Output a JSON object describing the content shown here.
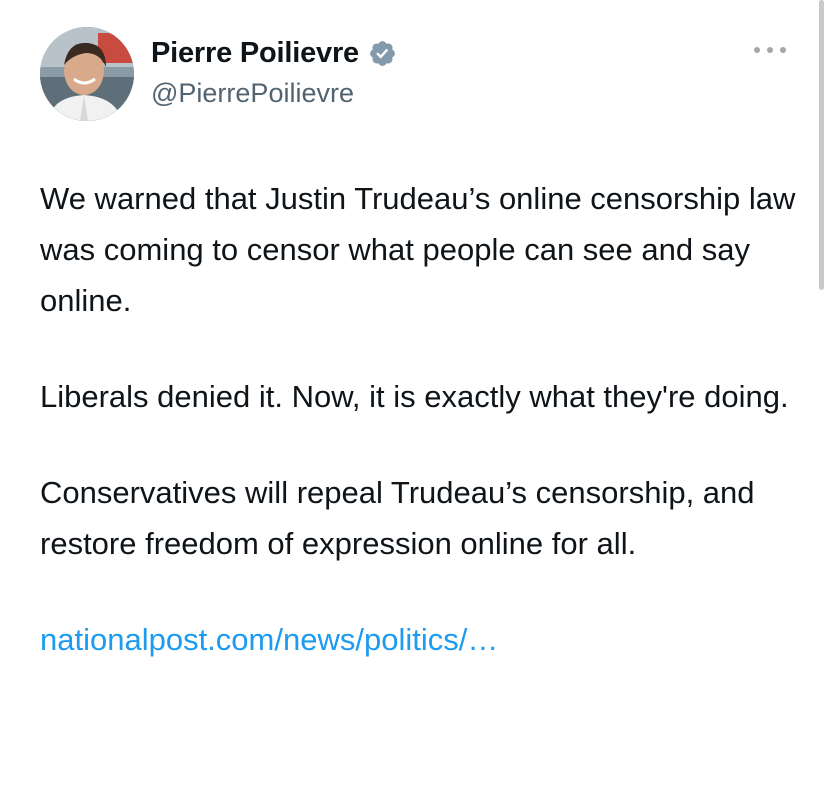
{
  "author": {
    "display_name": "Pierre Poilievre",
    "handle": "@PierrePoilievre",
    "verified_icon": "verified-badge-icon",
    "verified_color": "#829aab",
    "avatar_icon": "profile-photo"
  },
  "menu": {
    "more_icon": "more-horizontal-icon"
  },
  "tweet": {
    "paragraphs": [
      "We warned that Justin Trudeau’s online censorship law was coming to censor what people can see and say online.",
      "Liberals denied it. Now, it is exactly what they're doing.",
      "Conservatives will repeal Trudeau’s censorship, and restore freedom of expression online for all."
    ],
    "link_text": "nationalpost.com/news/politics/…"
  },
  "colors": {
    "text": "#0f1419",
    "secondary": "#536471",
    "link": "#1d9bf0"
  }
}
